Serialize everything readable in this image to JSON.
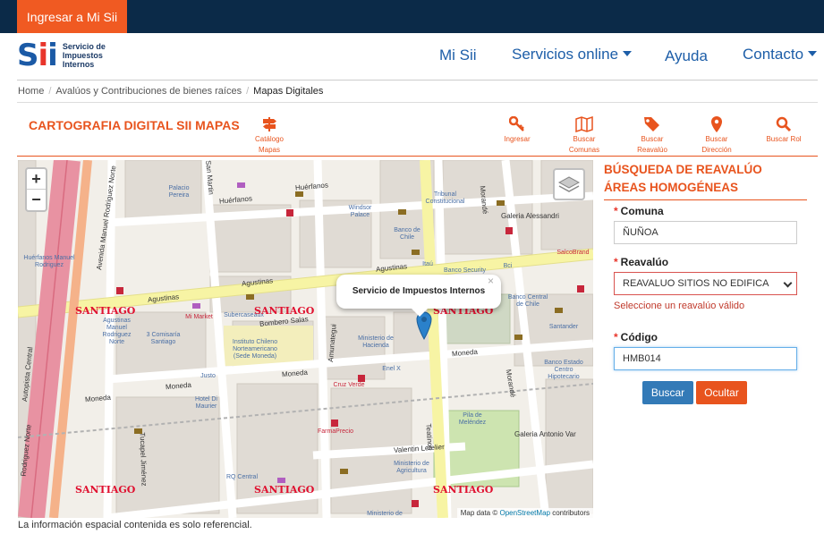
{
  "topbar": {
    "login": "Ingresar a Mi Sii"
  },
  "logo": {
    "mark": "Sii",
    "line1": "Servicio de",
    "line2": "Impuestos",
    "line3": "Internos"
  },
  "nav": {
    "mi_sii": "Mi Sii",
    "servicios": "Servicios online",
    "ayuda": "Ayuda",
    "contacto": "Contacto"
  },
  "breadcrumb": [
    "Home",
    "Avalúos y Contribuciones de bienes raíces",
    "Mapas Digitales"
  ],
  "page": {
    "title": "CARTOGRAFIA DIGITAL SII MAPAS"
  },
  "tools": {
    "catalogo": [
      "Catálogo",
      "Mapas"
    ],
    "ingresar": "Ingresar",
    "comunas": [
      "Buscar",
      "Comunas"
    ],
    "reavaluo": [
      "Buscar",
      "Reavalúo"
    ],
    "direccion": [
      "Buscar",
      "Dirección"
    ],
    "rol": "Buscar Rol"
  },
  "map": {
    "popup": "Servicio de Impuestos Internos",
    "popup_close": "×",
    "zoom_in": "+",
    "zoom_out": "−",
    "attribution_prefix": "Map data ©",
    "attribution_link": "OpenStreetMap",
    "attribution_suffix": "contributors",
    "santiago": "SANTIAGO",
    "streets": {
      "huerfanos": "Huérfanos",
      "huerfanos2": "Huérfanos",
      "agustinas": "Agustinas",
      "agustinas2": "Agustinas",
      "agustinas3": "Agustinas",
      "moneda": "Moneda",
      "moneda2": "Moneda",
      "moneda3": "Moneda",
      "moneda4": "Moneda",
      "bombero": "Bombero Salas",
      "amunategui": "Amunategui",
      "teatinos": "Teatinos",
      "morande": "Morandé",
      "morande2": "Morandé",
      "san_martin": "San Martin",
      "autopista": "Autopista Central",
      "manuel_rodriguez": "Avenida Manuel Rodriguez Norte",
      "valentin": "Valentin Letelier",
      "tucapel": "Tucapel Jiménez",
      "rodriguez_sur": "Rodriguez Norte",
      "galeria_alessandri": "Galeria Alessandri",
      "galeria_antonio": "Galeria Antonio Var"
    },
    "pois": {
      "palacio": "Palacio Pereira",
      "windsor": "Windsor Palace",
      "tribunal": "Tribunal Constitucional",
      "banco_chile": "Banco de Chile",
      "itau": "Itaú",
      "banco_security": "Banco Security",
      "ministerio_hacienda": "Ministerio de Hacienda",
      "banco_central": "Banco Central de Chile",
      "instituto": "Instituto Chileno Norteamericano (Sede Moneda)",
      "mi_market": "Mi Market",
      "subercaseaux": "Subercaseaux",
      "comisaria": "3 Comisaría Santiago",
      "agustinas_norte": "Agustinas Manuel Rodriguez Norte",
      "huerfanos_manuel": "Huérfanos Manuel Rodriguez",
      "hotel": "Hotel Di Maurier",
      "cruz_verde": "Cruz Verde",
      "enel": "Enel X",
      "farmaprecio": "FarmaPrecio",
      "pila": "Pila de Meléndez",
      "ministerio_agricultura": "Ministerio de Agricultura",
      "ministerio_educacion": "Ministerio de Educación",
      "santander": "Santander",
      "banco_estado": "Banco Estado Centro Hipotecario",
      "salcobrand": "SalcoBrand",
      "rq": "RQ Central",
      "justo": "Justo",
      "bci": "Bci"
    }
  },
  "footnote": "La información espacial contenida es solo referencial.",
  "panel": {
    "title_line1": "BÚSQUEDA DE REAVALÚO",
    "title_line2": "ÁREAS HOMOGÉNEAS",
    "comuna_label": "Comuna",
    "comuna_value": "ÑUÑOA",
    "reavaluo_label": "Reavalúo",
    "reavaluo_value": "REAVALUO SITIOS NO EDIFICA",
    "reavaluo_error": "Seleccione un reavalúo válido",
    "codigo_label": "Código",
    "codigo_value": "HMB014",
    "required": "*",
    "buscar": "Buscar",
    "ocultar": "Ocultar"
  },
  "colors": {
    "accent": "#e8541e",
    "navy": "#0b2a48",
    "link": "#1d5ea8",
    "button_blue": "#337ab7"
  }
}
